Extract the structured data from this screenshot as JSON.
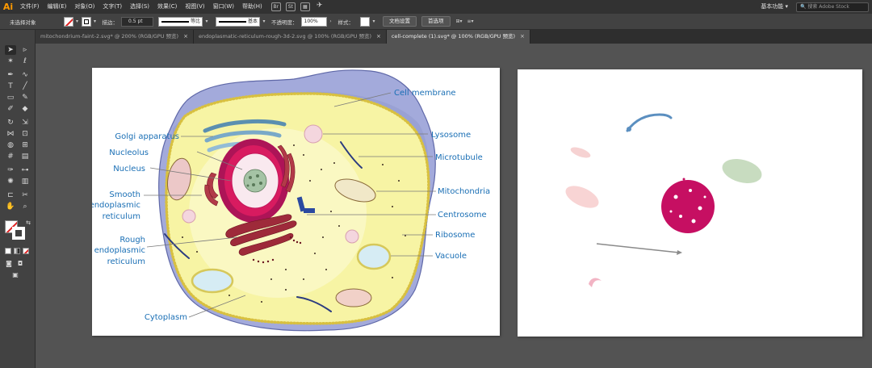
{
  "app": {
    "logo": "Ai",
    "menus": [
      "文件(F)",
      "编辑(E)",
      "对象(O)",
      "文字(T)",
      "选择(S)",
      "效果(C)",
      "视图(V)",
      "窗口(W)",
      "帮助(H)"
    ],
    "bridge_icon": "Br",
    "stock_icon": "St",
    "workspace": "基本功能",
    "search_placeholder": "搜索 Adobe Stock"
  },
  "control_bar": {
    "selection_status": "未选择对象",
    "stroke_label": "描边：",
    "stroke_weight": "0.5 pt",
    "profile_uniform": "等比",
    "brush_basic": "基本",
    "opacity_label": "不透明度：",
    "opacity_value": "100%",
    "style_label": "样式：",
    "doc_setup_button": "文档设置",
    "preferences_button": "首选项"
  },
  "tabs": [
    {
      "label": "mitochondrium-faint-2.svg* @ 200% (RGB/GPU 预览)",
      "active": false
    },
    {
      "label": "endoplasmatic-reticulum-rough-3d-2.svg @ 100% (RGB/GPU 预览)",
      "active": false
    },
    {
      "label": "cell-complete (1).svg* @ 100% (RGB/GPU 预览)",
      "active": true
    }
  ],
  "cell_labels": {
    "left": [
      {
        "text": "Golgi apparatus"
      },
      {
        "text": "Nucleolus"
      },
      {
        "text": "Nucleus"
      },
      {
        "text": "Smooth"
      },
      {
        "text": "endoplasmic"
      },
      {
        "text": "reticulum"
      },
      {
        "text": "Rough"
      },
      {
        "text": "endoplasmic"
      },
      {
        "text": "reticulum"
      },
      {
        "text": "Cytoplasm"
      }
    ],
    "right": [
      {
        "text": "Cell membrane"
      },
      {
        "text": "Lysosome"
      },
      {
        "text": "Microtubule"
      },
      {
        "text": "Mitochondria"
      },
      {
        "text": "Centrosome"
      },
      {
        "text": "Ribosome"
      },
      {
        "text": "Vacuole"
      }
    ]
  },
  "colors": {
    "label_blue": "#1a6fb5",
    "membrane_purple": "#9ba4d6",
    "cytoplasm_yellow": "#f7f3a0",
    "nucleus_red": "#c2185b",
    "ui_dark": "#535353"
  }
}
